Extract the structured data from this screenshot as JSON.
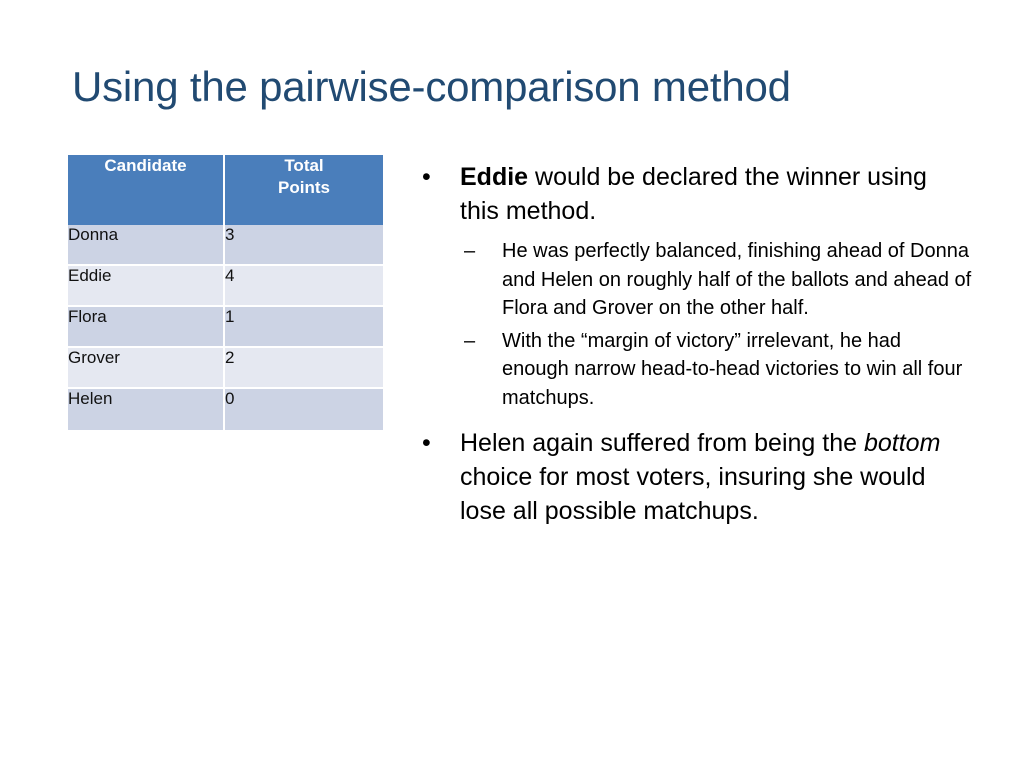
{
  "slide": {
    "title": "Using the pairwise-comparison method",
    "title_color": "#214a72",
    "background_color": "#ffffff"
  },
  "table": {
    "name": "total-points-table",
    "header_background": "#4a7ebb",
    "header_text_color": "#ffffff",
    "row_color_odd": "#ccd3e4",
    "row_color_even": "#e5e8f1",
    "columns": [
      "Candidate",
      "Total Points"
    ],
    "header_candidate": "Candidate",
    "header_points_line1": "Total",
    "header_points_line2": "Points",
    "rows": [
      {
        "candidate": "Donna",
        "points": "3"
      },
      {
        "candidate": "Eddie",
        "points": "4"
      },
      {
        "candidate": "Flora",
        "points": "1"
      },
      {
        "candidate": "Grover",
        "points": "2"
      },
      {
        "candidate": "Helen",
        "points": "0"
      }
    ]
  },
  "content": {
    "bullet_marker": "•",
    "sub_bullet_marker": "–",
    "bullet1": {
      "bold_lead": "Eddie",
      "rest": " would be declared the winner using this method.",
      "sub": [
        "He was perfectly balanced, finishing ahead of Donna and Helen on roughly half of the ballots and ahead of Flora and Grover on the other half.",
        "With the “margin of victory” irrelevant, he had enough narrow head-to-head victories to win all four matchups."
      ]
    },
    "bullet2": {
      "part1": "Helen again suffered from being the ",
      "italic": "bottom",
      "part2": " choice for most voters, insuring she would lose all possible matchups."
    }
  }
}
